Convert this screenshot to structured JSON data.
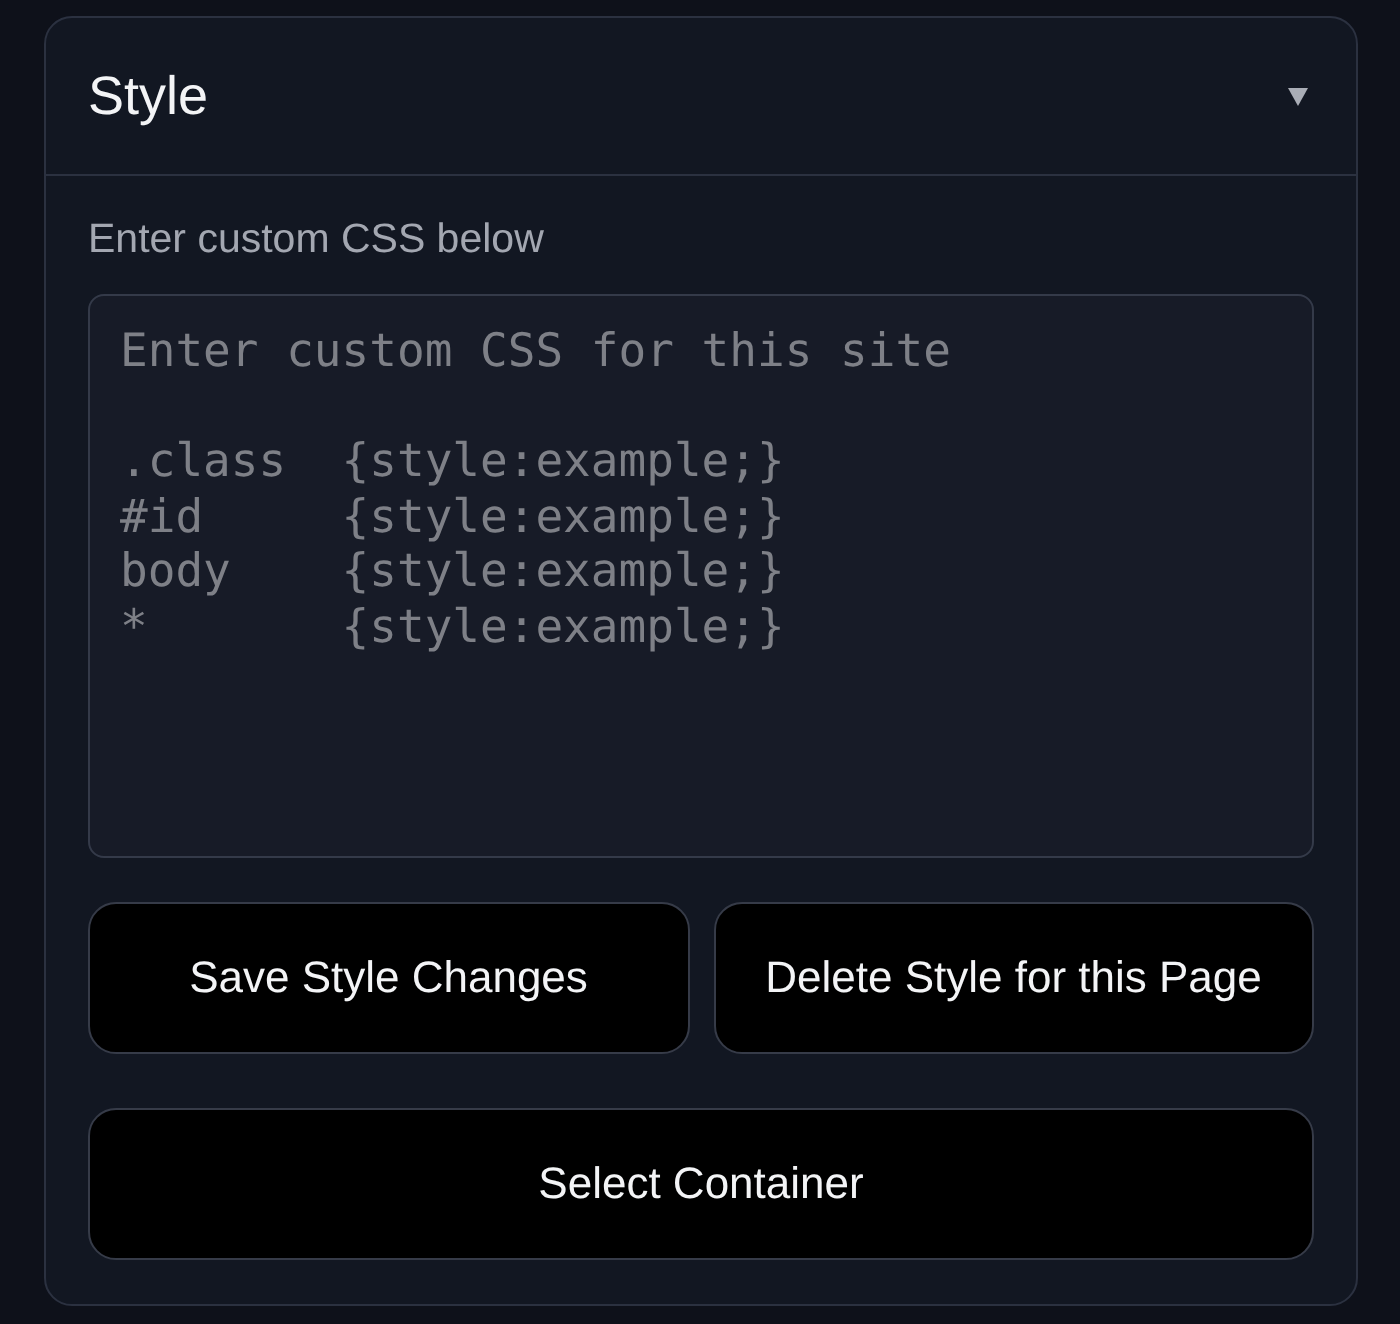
{
  "panel": {
    "title": "Style",
    "expanded": true
  },
  "css_editor": {
    "label": "Enter custom CSS below",
    "placeholder": "Enter custom CSS for this site\n\n.class  {style:example;}\n#id     {style:example;}\nbody    {style:example;}\n*       {style:example;}"
  },
  "buttons": [
    {
      "label": "Save Style Changes"
    },
    {
      "label": "Delete Style for this Page"
    },
    {
      "label": "Select Container"
    }
  ]
}
